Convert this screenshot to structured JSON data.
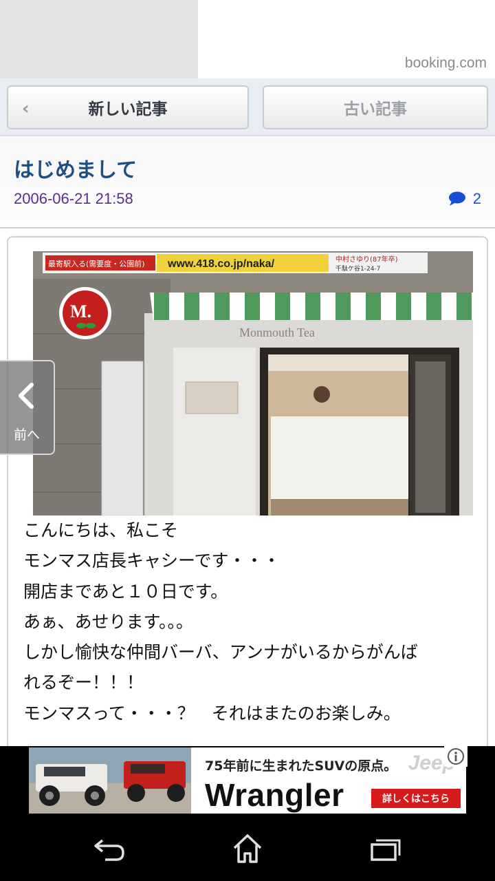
{
  "top_ad": {
    "source_label": "booking.com"
  },
  "article_nav": {
    "newer_label": "新しい記事",
    "older_label": "古い記事"
  },
  "article": {
    "title": "はじめまして",
    "date": "2006-06-21 21:58",
    "comment_count": "2",
    "photo_texts": {
      "banner_left": "最寄駅入る(需要度・公園前)",
      "banner_url": "www.418.co.jp/naka/",
      "banner_right_1": "中村さゆり(87年卒)",
      "banner_right_2": "千駄ケ谷1-24-7",
      "logo": "M.",
      "awning_sign": "Monmouth Tea"
    },
    "body_lines": [
      "こんにちは、私こそ",
      "モンマス店長キャシーです・・・",
      "開店まであと１０日です。",
      "あぁ、あせります。。。",
      "しかし愉快な仲間バーバ、アンナがいるからがんば",
      "れるぞー！！！",
      "モンマスって・・・？　それはまたのお楽しみ。"
    ]
  },
  "prev_tab": {
    "label": "前へ"
  },
  "bottom_ad": {
    "tagline": "75年前に生まれたSUVの原点。",
    "brand": "Jeep",
    "model": "Wrangler",
    "cta": "詳しくはこちら"
  },
  "colors": {
    "title": "#1e4f84",
    "date": "#5a2e91",
    "comment": "#1a4dd6",
    "cta": "#d8191d"
  },
  "icons": {
    "nav_prev": "chevron-left-icon",
    "comment": "speech-bubble-icon",
    "prev_tab": "chevron-left-icon",
    "ad_info": "info-icon",
    "sys_back": "back-icon",
    "sys_home": "home-icon",
    "sys_recents": "recents-icon"
  }
}
